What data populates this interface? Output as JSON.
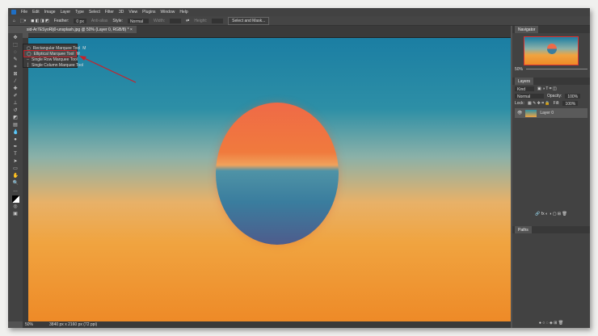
{
  "menu": [
    "File",
    "Edit",
    "Image",
    "Layer",
    "Type",
    "Select",
    "Filter",
    "3D",
    "View",
    "Plugins",
    "Window",
    "Help"
  ],
  "options": {
    "feather_label": "Feather:",
    "feather_value": "0 px",
    "antialias": "Anti-alias",
    "style_label": "Style:",
    "style_value": "Normal",
    "width_label": "Width:",
    "height_label": "Height:",
    "select_mask": "Select and Mask..."
  },
  "document_tab": "sid-Ar7ESyoRlj0-unsplash.jpg @ 50% (Layer 0, RGB/8) *",
  "flyout": [
    {
      "label": "Rectangular Marquee Tool",
      "key": "M"
    },
    {
      "label": "Elliptical Marquee Tool",
      "key": "M",
      "selected": true
    },
    {
      "label": "Single Row Marquee Tool",
      "key": ""
    },
    {
      "label": "Single Column Marquee Tool",
      "key": ""
    }
  ],
  "status": {
    "zoom": "50%",
    "size": "3840 px x 2160 px (72 ppi)"
  },
  "navigator": {
    "title": "Navigator",
    "zoom": "50%"
  },
  "layers": {
    "title": "Layers",
    "kind": "Kind",
    "blend": "Normal",
    "opacity_label": "Opacity:",
    "opacity": "100%",
    "lock_label": "Lock:",
    "fill_label": "Fill:",
    "fill": "100%",
    "layer_name": "Layer 0"
  },
  "paths": {
    "title": "Paths"
  },
  "colors": {
    "highlight": "#c8212a"
  }
}
